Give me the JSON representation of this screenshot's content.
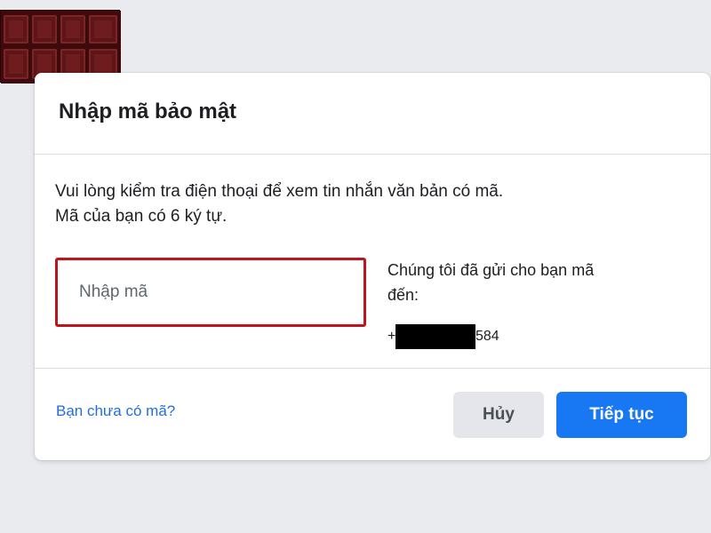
{
  "logo": {
    "icon": "chocolate-bar-icon",
    "colors": {
      "base": "#3f0a0b",
      "piece": "#6b1a1c",
      "highlight": "#8a2a2c"
    }
  },
  "dialog": {
    "title": "Nhập mã bảo mật",
    "instruction_line1": "Vui lòng kiểm tra điện thoại để xem tin nhắn văn bản có mã.",
    "instruction_line2": "Mã của bạn có 6 ký tự.",
    "code_input": {
      "placeholder": "Nhập mã",
      "value": "",
      "border_color": "#c0141c"
    },
    "sent_info_line1": "Chúng tôi đã gửi cho bạn mã",
    "sent_info_line2": "đến:",
    "phone_prefix": "+",
    "phone_suffix": "584"
  },
  "footer": {
    "no_code_link": "Bạn chưa có mã?",
    "cancel_label": "Hủy",
    "continue_label": "Tiếp tục"
  },
  "colors": {
    "accent": "#1877f2",
    "link": "#216fdb",
    "background": "#e9ebee"
  }
}
